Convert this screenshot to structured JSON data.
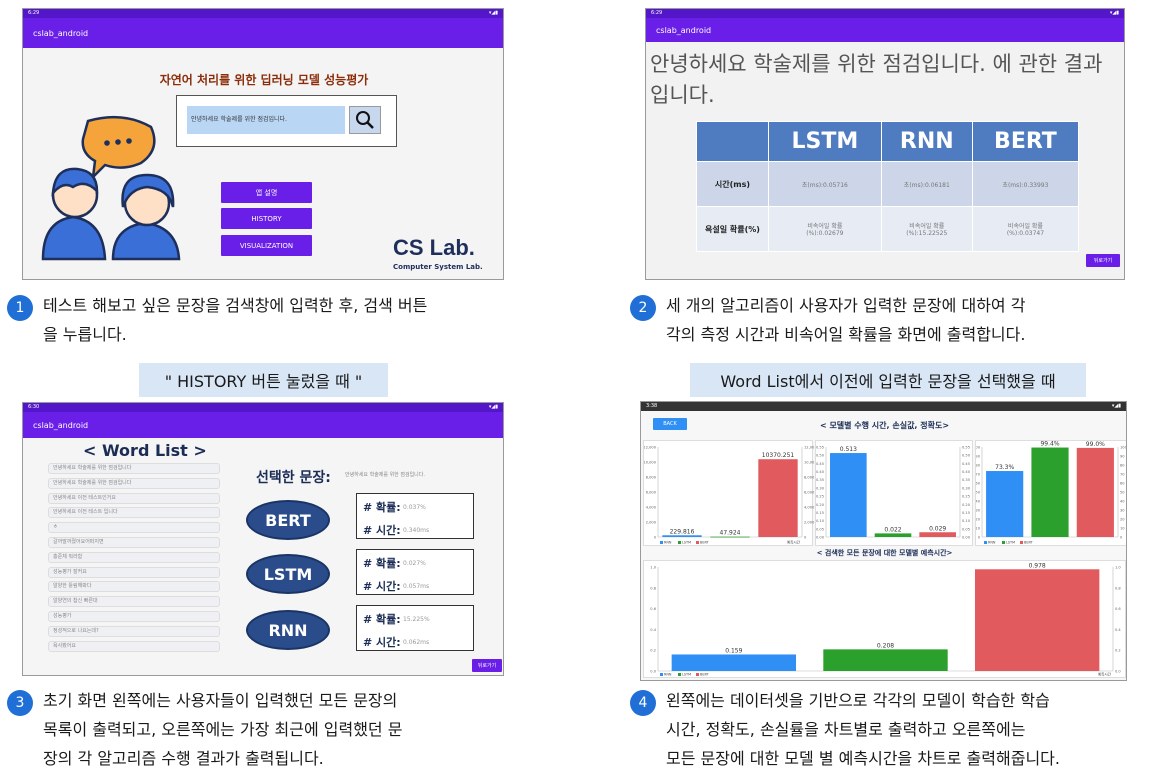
{
  "common": {
    "status_time1": "6:29",
    "status_time3": "6:30",
    "status_time4": "3:38",
    "app_name": "cslab_android",
    "back_label": "뒤로가기"
  },
  "s1": {
    "title": "자연어 처리를 위한 딥러닝 모델 성능평가",
    "search_value": "안녕하세요 학술제를 위한 점검입니다.",
    "btn_app": "앱 설명",
    "btn_history": "HISTORY",
    "btn_vis": "VISUALIZATION",
    "logo": "CS Lab.",
    "logo_sub": "Computer System Lab."
  },
  "s2": {
    "heading": "안녕하세요 학술제를 위한 점검입니다. 에 관한 결과입니다.",
    "headers": [
      "LSTM",
      "RNN",
      "BERT"
    ],
    "row1_label": "시간(ms)",
    "row1": [
      "초(ms):0.05716",
      "초(ms):0.06181",
      "초(ms):0.33993"
    ],
    "row2_label": "욕설일 확률(%)",
    "row2": [
      "비속어일 확률\n(%):0.02679",
      "비속어일 확률\n(%):15.22525",
      "비속어일 확률\n(%):0.03747"
    ]
  },
  "s3": {
    "title": "< Word List >",
    "selected_label": "선택한 문장:",
    "selected_value": "안녕하세요 학술제를 위한 점검입니다.",
    "items": [
      "안녕하세요 학술제를 위한 점검입니다",
      "안녕하세요 학술제를 위한 점검입니다",
      "안녕하세요 이전 테스트인거요",
      "안녕하세요 이전 테스트 입니다",
      "ㅎ",
      "갈까말까졌어요어떠지면",
      "홍준체 뭐라함",
      "성능평가 잘커요",
      "알양한 틀림해봐다",
      "알양연의 찹신 빠른대",
      "성능평가",
      "정성적으로 나요는데?",
      "욕사봤어요"
    ],
    "models": [
      "BERT",
      "LSTM",
      "RNN"
    ],
    "prob_label": "# 확률:",
    "time_label": "# 시간:",
    "probs": [
      "0.037%",
      "0.027%",
      "15.225%"
    ],
    "times": [
      "0.340ms",
      "0.057ms",
      "0.062ms"
    ]
  },
  "s4": {
    "back": "BACK",
    "chart_title": "< 모델별 수행 시간, 손실값, 정확도>",
    "chart2_title": "< 검색한 모든 문장에 대한 모델별 예측시간>",
    "legend": [
      "RNN",
      "LSTM",
      "BERT"
    ],
    "axis_caption": "예측시간"
  },
  "chart_data": [
    {
      "type": "bar",
      "title": "< 모델별 수행 시간, 손실값, 정확도>",
      "subtitle": "수행 시간",
      "categories": [
        "RNN",
        "LSTM",
        "BERT"
      ],
      "values": [
        229.816,
        47.924,
        10370.251
      ],
      "ylim": [
        0,
        12000
      ],
      "colors": [
        "#2f8ff5",
        "#2ca02c",
        "#e05a5e"
      ]
    },
    {
      "type": "bar",
      "subtitle": "손실값",
      "categories": [
        "RNN",
        "LSTM",
        "BERT"
      ],
      "values": [
        0.513,
        0.022,
        0.029
      ],
      "ylim": [
        0,
        0.55
      ],
      "colors": [
        "#2f8ff5",
        "#2ca02c",
        "#e05a5e"
      ]
    },
    {
      "type": "bar",
      "subtitle": "정확도",
      "categories": [
        "RNN",
        "LSTM",
        "BERT"
      ],
      "values": [
        73.3,
        99.4,
        99.0
      ],
      "labels": [
        "73.3%",
        "99.4%",
        "99.0%"
      ],
      "ylim": [
        0,
        100
      ],
      "colors": [
        "#2f8ff5",
        "#2ca02c",
        "#e05a5e"
      ]
    },
    {
      "type": "bar",
      "title": "< 검색한 모든 문장에 대한 모델별 예측시간>",
      "categories": [
        "RNN",
        "LSTM",
        "BERT"
      ],
      "values": [
        0.159,
        0.208,
        0.978
      ],
      "ylim": [
        0,
        1.0
      ],
      "colors": [
        "#2f8ff5",
        "#2ca02c",
        "#e05a5e"
      ]
    }
  ],
  "captions": {
    "c1_num": "1",
    "c1a": "테스트 해보고 싶은 문장을 검색창에 입력한 후, 검색 버튼",
    "c1b": "을 누릅니다.",
    "c2_num": "2",
    "c2a": "세 개의 알고리즘이 사용자가 입력한 문장에 대하여 각",
    "c2b": "각의 측정 시간과 비속어일 확률을 화면에 출력합니다.",
    "c3_num": "3",
    "c3a": "초기 화면 왼쪽에는 사용자들이 입력했던 모든 문장의",
    "c3b": "목록이 출력되고, 오른쪽에는  가장 최근에 입력했던 문",
    "c3c": "장의 각 알고리즘 수행 결과가 출력됩니다.",
    "c4_num": "4",
    "c4a": "왼쪽에는 데이터셋을 기반으로 각각의 모델이 학습한 학습",
    "c4b": "시간, 정확도, 손실률을 차트별로 출력하고 오른쪽에는",
    "c4c": "모든 문장에 대한 모델 별 예측시간을 차트로 출력해줍니다.",
    "band3": "\" HISTORY 버튼 눌렀을 때 \"",
    "band4": "Word List에서 이전에 입력한 문장을 선택했을 때"
  }
}
